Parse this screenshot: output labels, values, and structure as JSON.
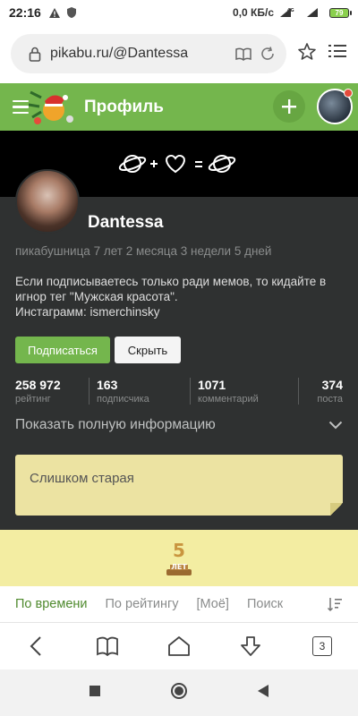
{
  "status_bar": {
    "time": "22:16",
    "net_speed": "0,0 КБ/с",
    "network": "4G",
    "battery": "79"
  },
  "browser": {
    "url": "pikabu.ru/@Dantessa",
    "tabs_count": "3"
  },
  "header": {
    "title": "Профиль"
  },
  "profile": {
    "username": "Dantessa",
    "since": "пикабушница 7 лет 2 месяца 3 недели 5 дней",
    "bio_line1": "Если подписываетесь только ради мемов, то кидайте в игнор тег \"Мужская красота\".",
    "bio_line2": "Инстаграмм: ismerchinsky",
    "subscribe_label": "Подписаться",
    "hide_label": "Скрыть",
    "stats": [
      {
        "value": "258 972",
        "label": "рейтинг"
      },
      {
        "value": "163",
        "label": "подписчика"
      },
      {
        "value": "1071",
        "label": "комментарий"
      },
      {
        "value": "374",
        "label": "поста"
      }
    ],
    "show_info_label": "Показать полную информацию",
    "note_text": "Слишком старая"
  },
  "award": {
    "number": "5",
    "label": "ЛЕТ"
  },
  "sort_tabs": [
    {
      "label": "По времени",
      "active": true
    },
    {
      "label": "По рейтингу"
    },
    {
      "label": "[Моё]"
    },
    {
      "label": "Поиск"
    }
  ],
  "colors": {
    "brand_green": "#74b64d",
    "profile_bg": "#2f3131",
    "note_bg": "#ece3a2"
  }
}
